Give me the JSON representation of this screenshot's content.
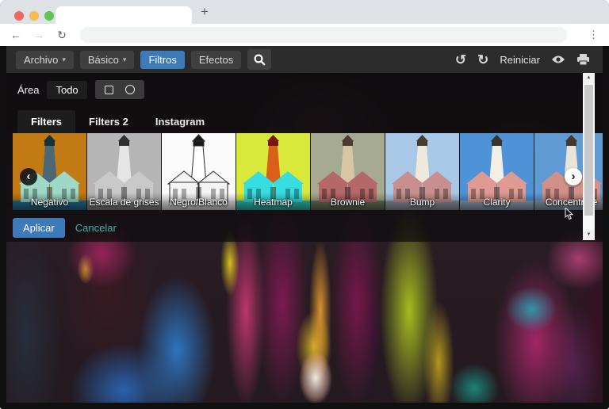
{
  "browser": {
    "traffic_lights": {
      "close": "#ee6a5f",
      "minimize": "#f5bd4f",
      "maximize": "#61c454"
    },
    "new_tab_label": "+",
    "url_value": "",
    "url_placeholder": ""
  },
  "icons": {
    "back": "←",
    "forward": "→",
    "refresh": "↻",
    "menu_dots": "⋮",
    "undo": "↺",
    "redo": "↻",
    "caret": "▾",
    "carousel_prev": "‹",
    "carousel_next": "›",
    "scroll_up": "▲",
    "scroll_down": "▼"
  },
  "toolbar": {
    "menus": [
      {
        "label": "Archivo",
        "caret": true,
        "active": false
      },
      {
        "label": "Básico",
        "caret": true,
        "active": false
      },
      {
        "label": "Filtros",
        "caret": false,
        "active": true
      },
      {
        "label": "Efectos",
        "caret": false,
        "active": false
      }
    ],
    "reset_label": "Reiniciar",
    "accent_color": "#3d7ab8"
  },
  "filter_panel": {
    "area_label": "Área",
    "todo_label": "Todo",
    "tabs": [
      {
        "label": "Filters",
        "active": true
      },
      {
        "label": "Filters 2",
        "active": false
      },
      {
        "label": "Instagram",
        "active": false
      }
    ],
    "apply_label": "Aplicar",
    "cancel_label": "Cancelar",
    "cancel_color": "#3cb3a0",
    "filters": [
      {
        "label": "Negativo",
        "palette": {
          "sky": "#c27a14",
          "tower": "#4a6875",
          "towerTop": "#16323e",
          "building": "#9ed8c6",
          "ground": "#207292"
        }
      },
      {
        "label": "Escala de grises",
        "palette": {
          "sky": "#b5b5b5",
          "tower": "#e5e5e5",
          "towerTop": "#2f2f2f",
          "building": "#c9c9c9",
          "ground": "#909090"
        }
      },
      {
        "label": "Negro/Blanco",
        "palette": {
          "sky": "#fbfbfb",
          "tower": "#ffffff",
          "towerTop": "#1a1a1a",
          "building": "#f4f4f4",
          "ground": "#ececec",
          "stroke": "#2a2a2a"
        }
      },
      {
        "label": "Heatmap",
        "palette": {
          "sky": "#d9e93a",
          "tower": "#d96018",
          "towerTop": "#7c150c",
          "building": "#38dde2",
          "ground": "#2cc3b4"
        }
      },
      {
        "label": "Brownie",
        "palette": {
          "sky": "#a6aa90",
          "tower": "#d6c6a4",
          "towerTop": "#4e3a30",
          "building": "#b56868",
          "ground": "#68755a"
        }
      },
      {
        "label": "Bump",
        "palette": {
          "sky": "#a9c7e6",
          "tower": "#efe9db",
          "towerTop": "#4a3a2e",
          "building": "#c88f8f",
          "ground": "#8d9aa4"
        }
      },
      {
        "label": "Clarity",
        "palette": {
          "sky": "#4e92d8",
          "tower": "#f4efe6",
          "towerTop": "#3c3226",
          "building": "#df9b93",
          "ground": "#8da6ba"
        }
      },
      {
        "label": "Concentrate",
        "palette": {
          "sky": "#5f9bd2",
          "tower": "#eae4d8",
          "towerTop": "#463828",
          "building": "#d29089",
          "ground": "#8ba0b2"
        }
      }
    ]
  }
}
